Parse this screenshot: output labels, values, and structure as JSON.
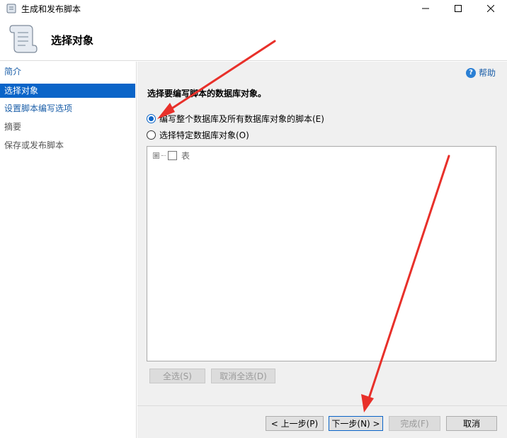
{
  "window": {
    "title": "生成和发布脚本"
  },
  "header": {
    "title": "选择对象"
  },
  "nav": {
    "items": [
      {
        "label": "简介"
      },
      {
        "label": "选择对象"
      },
      {
        "label": "设置脚本编写选项"
      },
      {
        "label": "摘要"
      },
      {
        "label": "保存或发布脚本"
      }
    ],
    "active_index": 1
  },
  "main": {
    "help_label": "帮助",
    "prompt": "选择要编写脚本的数据库对象。",
    "options": [
      {
        "label": "编写整个数据库及所有数据库对象的脚本(E)",
        "checked": true
      },
      {
        "label": "选择特定数据库对象(O)",
        "checked": false
      }
    ],
    "tree": {
      "items": [
        {
          "label": "表",
          "expander": "⊞"
        }
      ]
    },
    "select_all_label": "全选(S)",
    "deselect_all_label": "取消全选(D)"
  },
  "footer": {
    "prev_label": "< 上一步(P)",
    "next_label": "下一步(N) >",
    "finish_label": "完成(F)",
    "cancel_label": "取消"
  },
  "colors": {
    "accent": "#0a64c8",
    "link": "#1a5ea8",
    "annotation_arrow": "#e8302a"
  }
}
